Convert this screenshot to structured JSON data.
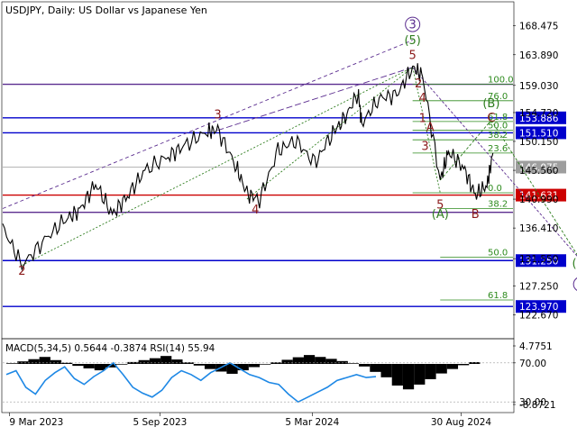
{
  "header": {
    "symbol": "USDJPY",
    "timeframe": "Daily",
    "description": "US Dollar vs Japanese Yen"
  },
  "colors": {
    "background": "#ffffff",
    "candles": "#000000",
    "wave_labels": "#8b1a1a",
    "elliott_major": "#5b2d8f",
    "elliott_green": "#2e7d1e",
    "fib_lines": "#2e8b1e",
    "level_blue": "#0000cc",
    "level_red": "#cc0000",
    "macd_line": "#1e88e5"
  },
  "chart_data": [
    {
      "type": "line",
      "title": "USDJPY, Daily: US Dollar vs Japanese Yen",
      "price_axis_ticks": [
        168.475,
        163.89,
        159.03,
        154.72,
        150.15,
        145.56,
        140.99,
        136.41,
        131.55,
        127.25,
        122.67
      ],
      "ylim": [
        119.0,
        172.0
      ],
      "x_tick_labels": [
        "9 Mar 2023",
        "5 Sep 2023",
        "5 Mar 2024",
        "30 Aug 2024"
      ],
      "xlim": [
        "2023-03-01",
        "2024-10-31"
      ],
      "price_series": {
        "x": [
          "2023-03-01",
          "2023-03-24",
          "2023-04-20",
          "2023-05-15",
          "2023-06-01",
          "2023-06-20",
          "2023-07-10",
          "2023-07-28",
          "2023-08-18",
          "2023-09-15",
          "2023-10-05",
          "2023-10-31",
          "2023-11-13",
          "2023-12-04",
          "2023-12-18",
          "2024-01-02",
          "2024-01-24",
          "2024-02-14",
          "2024-03-08",
          "2024-03-28",
          "2024-04-12",
          "2024-04-29",
          "2024-05-03",
          "2024-05-24",
          "2024-06-14",
          "2024-07-03",
          "2024-07-15",
          "2024-08-05",
          "2024-08-15",
          "2024-09-02",
          "2024-09-16",
          "2024-09-30",
          "2024-10-07"
        ],
        "y": [
          136.5,
          130.5,
          134.5,
          137.8,
          139.2,
          143.5,
          138.5,
          141.5,
          145.5,
          147.8,
          149.5,
          151.7,
          151.9,
          146.5,
          141.8,
          141.0,
          148.5,
          150.5,
          146.5,
          151.4,
          153.5,
          158.0,
          152.9,
          157.0,
          157.5,
          161.9,
          160.5,
          144.0,
          148.5,
          146.0,
          141.6,
          143.2,
          148.3
        ]
      },
      "levels": [
        {
          "name": "level-168",
          "value": 159.2,
          "color": "#5b2d8f",
          "label": ""
        },
        {
          "name": "level-153",
          "value": 153.886,
          "color": "#0000cc",
          "label": "153.886"
        },
        {
          "name": "level-151",
          "value": 151.51,
          "color": "#0000cc",
          "label": "151.510"
        },
        {
          "name": "level-146",
          "value": 146.075,
          "color": "#9e9e9e",
          "label": "146.075"
        },
        {
          "name": "level-141",
          "value": 141.631,
          "color": "#cc0000",
          "label": "141.631"
        },
        {
          "name": "level-139",
          "value": 138.9,
          "color": "#5b2d8f",
          "label": ""
        },
        {
          "name": "level-131",
          "value": 131.25,
          "color": "#0000cc",
          "label": "131.250"
        },
        {
          "name": "level-123",
          "value": 123.97,
          "color": "#0000cc",
          "label": "123.970"
        }
      ],
      "fib_retracement_upper": [
        {
          "label": "100.0",
          "value": 159.2
        },
        {
          "label": "76.0",
          "value": 156.6
        },
        {
          "label": "61.8",
          "value": 153.3
        },
        {
          "label": "50.0",
          "value": 151.9
        },
        {
          "label": "38.2",
          "value": 150.4
        },
        {
          "label": "23.6",
          "value": 148.3
        },
        {
          "label": "0.0",
          "value": 142.0
        }
      ],
      "fib_retracement_lower": [
        {
          "label": "38.2",
          "value": 139.5
        },
        {
          "label": "50.0",
          "value": 131.8
        },
        {
          "label": "61.8",
          "value": 125.0
        }
      ],
      "wave_labels": [
        {
          "text": "2",
          "date": "2023-03-24",
          "price": 129.0,
          "style": "red"
        },
        {
          "text": "3",
          "date": "2023-11-13",
          "price": 153.8,
          "style": "red"
        },
        {
          "text": "4",
          "date": "2023-12-28",
          "price": 138.7,
          "style": "red"
        },
        {
          "text": "5",
          "date": "2024-07-03",
          "price": 163.2,
          "style": "red"
        },
        {
          "text": "2",
          "date": "2024-07-10",
          "price": 158.7,
          "style": "red"
        },
        {
          "text": "4",
          "date": "2024-07-15",
          "price": 156.4,
          "style": "red"
        },
        {
          "text": "1",
          "date": "2024-07-15",
          "price": 153.2,
          "style": "red"
        },
        {
          "text": "3",
          "date": "2024-07-18",
          "price": 148.8,
          "style": "red"
        },
        {
          "text": "5",
          "date": "2024-08-05",
          "price": 139.5,
          "style": "red"
        },
        {
          "text": "A",
          "date": "2024-07-24",
          "price": 151.8,
          "style": "red"
        },
        {
          "text": "B",
          "date": "2024-09-16",
          "price": 138.0,
          "style": "red"
        },
        {
          "text": "C",
          "date": "2024-10-05",
          "price": 153.3,
          "style": "red"
        },
        {
          "text": "(A)",
          "date": "2024-08-05",
          "price": 138.0,
          "style": "green"
        },
        {
          "text": "(B)",
          "date": "2024-10-05",
          "price": 155.6,
          "style": "green"
        },
        {
          "text": "(5)",
          "date": "2024-07-03",
          "price": 165.6,
          "style": "green"
        },
        {
          "text": "(C)",
          "date": "2025-01-20",
          "price": 130.2,
          "style": "green"
        },
        {
          "text": "3",
          "date": "2024-07-03",
          "price": 168.7,
          "style": "circled"
        },
        {
          "text": "4",
          "date": "2025-01-20",
          "price": 127.5,
          "style": "circled"
        }
      ]
    },
    {
      "type": "line",
      "title": "MACD(5,34,5) 0.5644 -0.3874 RSI(14) 55.94",
      "indicator_axis_ticks": [
        "4.7751",
        "70.00",
        "30.00",
        "-8.8721"
      ],
      "rsi_series": [
        58,
        62,
        45,
        38,
        52,
        60,
        66,
        54,
        48,
        56,
        62,
        70,
        58,
        45,
        39,
        35,
        42,
        55,
        62,
        58,
        52,
        60,
        65,
        70,
        64,
        58,
        55,
        50,
        48,
        38,
        30,
        35,
        40,
        45,
        52,
        55,
        58,
        55,
        55.94
      ],
      "macd_histogram": [
        0.2,
        0.8,
        1.5,
        2.2,
        1.2,
        0.4,
        -0.6,
        -1.4,
        -2.0,
        -1.1,
        -0.2,
        0.6,
        1.2,
        1.8,
        2.5,
        1.4,
        0.5,
        -0.5,
        -1.6,
        -2.4,
        -3.1,
        -2.0,
        -1.0,
        -0.2,
        0.5,
        1.3,
        2.1,
        2.8,
        2.2,
        1.6,
        0.9,
        0.2,
        -0.8,
        -2.5,
        -4.2,
        -6.8,
        -8.0,
        -6.5,
        -4.8,
        -3.0,
        -1.6,
        -0.4,
        0.56
      ]
    }
  ]
}
